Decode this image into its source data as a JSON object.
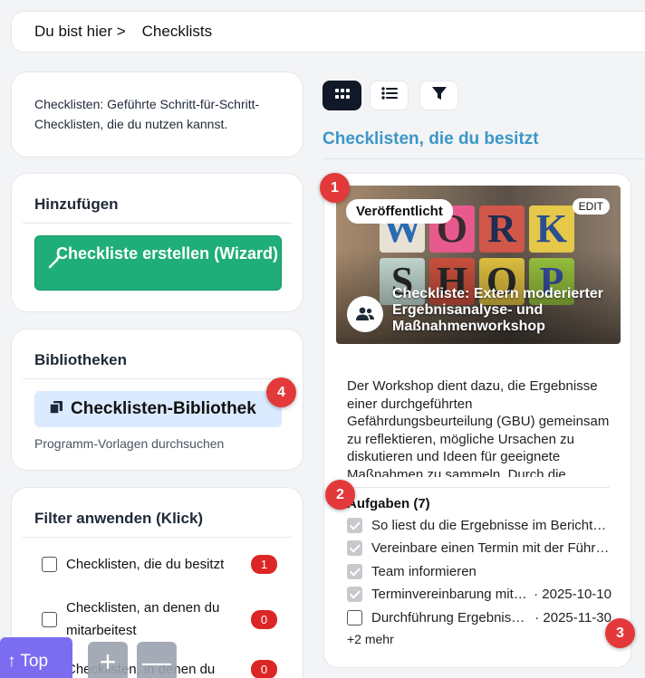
{
  "breadcrumb": {
    "prefix": "Du bist hier",
    "separator": ">",
    "current": "Checklists"
  },
  "description": "Checklisten: Geführte Schritt-für-Schritt-Checklisten, die du nutzen kannst.",
  "add": {
    "title": "Hinzufügen",
    "wizard_label": "Checkliste erstellen (Wizard)",
    "wizard_icon": "magic-wand-icon"
  },
  "library": {
    "title": "Bibliotheken",
    "button_label": "Checklisten-Bibliothek",
    "button_icon": "copy-icon",
    "subtitle": "Programm-Vorlagen durchsuchen"
  },
  "filter": {
    "title": "Filter anwenden (Klick)",
    "items": [
      {
        "label": "Checklisten, die du besitzt",
        "count": "1"
      },
      {
        "label": "Checklisten, an denen du mitarbeitest",
        "count": "0"
      },
      {
        "label": "Checklisten, in denen du",
        "count": "0"
      }
    ]
  },
  "views": {
    "grid_icon": "grid-icon",
    "list_icon": "list-icon",
    "filter_icon": "filter-icon"
  },
  "section_title": "Checklisten, die du besitzt",
  "checklist": {
    "status": "Veröffentlicht",
    "edit_label": "EDIT",
    "title": "Checkliste: Extern moderierter Ergebnisanalyse- und Maßnahmenworkshop",
    "image_letters": [
      "W",
      "O",
      "R",
      "K",
      "S",
      "H",
      "O",
      "P"
    ],
    "description": "Der Workshop dient dazu, die Ergebnisse einer durchgeführten Gefährdungsbeurteilung (GBU) gemeinsam zu reflektieren, mögliche Ursachen zu diskutieren und Ideen für geeignete Maßnahmen zu sammeln. Durch die",
    "tasks_title": "Aufgaben (7)",
    "tasks": [
      {
        "text": "So liest du die Ergebnisse im Berichts…",
        "date": "",
        "done": true
      },
      {
        "text": "Vereinbare einen Termin mit der Führ…",
        "date": "",
        "done": true
      },
      {
        "text": "Team informieren",
        "date": "",
        "done": true
      },
      {
        "text": "Terminvereinbarung mit …",
        "date": "· 2025-10-10",
        "done": true
      },
      {
        "text": "Durchführung Ergebnisa…",
        "date": "· 2025-11-30",
        "done": false
      }
    ],
    "more": "+2 mehr"
  },
  "markers": [
    "1",
    "2",
    "3",
    "4"
  ],
  "controls": {
    "top_label": "↑ Top",
    "zoom_in": "+",
    "zoom_out": "—"
  }
}
